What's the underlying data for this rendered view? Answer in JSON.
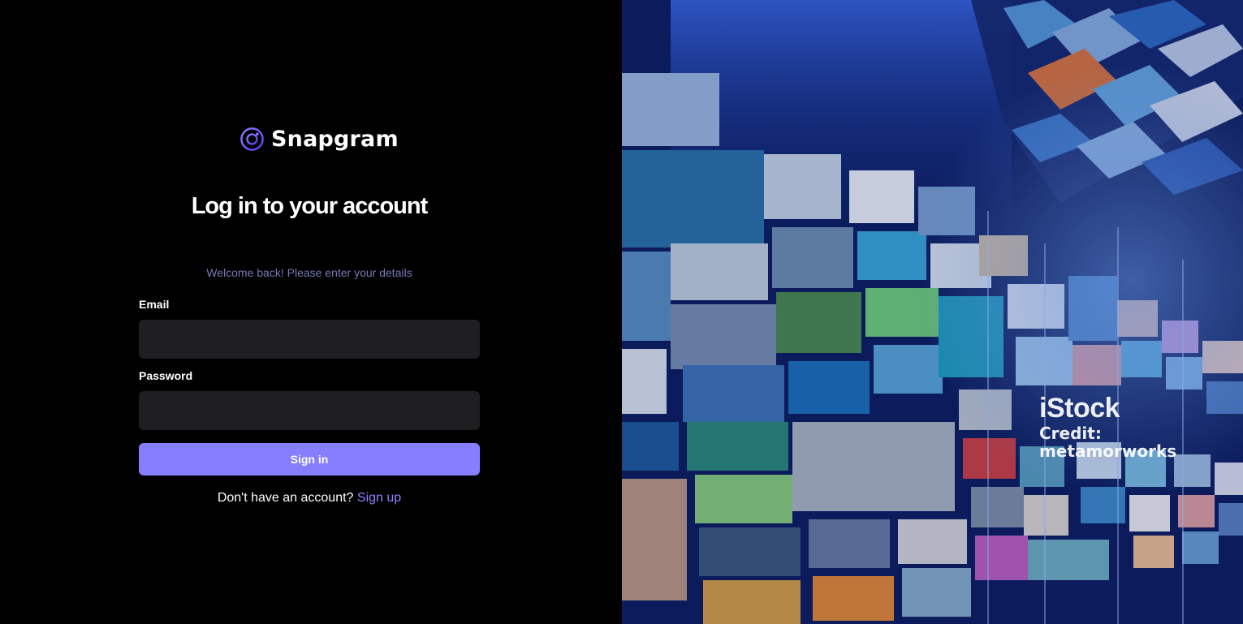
{
  "app": {
    "name": "Snapgram",
    "accent_color": "#877eff"
  },
  "login": {
    "title": "Log in to your account",
    "subtitle": "Welcome back! Please enter your details",
    "email_label": "Email",
    "email_value": "",
    "password_label": "Password",
    "password_value": "",
    "signin_label": "Sign in",
    "signup_prompt": "Don't have an account?",
    "signup_link": "Sign up"
  },
  "hero": {
    "watermark_brand": "iStock",
    "watermark_credit": "Credit: metamorworks"
  }
}
